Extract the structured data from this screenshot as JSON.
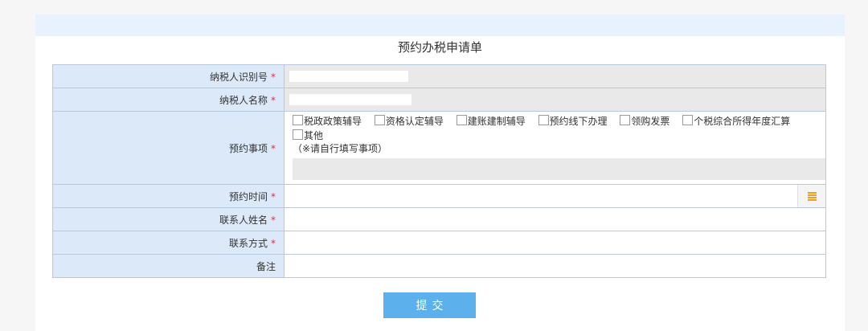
{
  "form": {
    "title": "预约办税申请单",
    "required_mark": "*",
    "fields": {
      "taxpayer_id": {
        "label": "纳税人识别号"
      },
      "taxpayer_name": {
        "label": "纳税人名称"
      },
      "appointment_matters": {
        "label": "预约事项",
        "options": [
          "税政政策辅导",
          "资格认定辅导",
          "建账建制辅导",
          "预约线下办理",
          "领购发票",
          "个税综合所得年度汇算",
          "其他"
        ],
        "hint": "（※请自行填写事项）"
      },
      "appointment_time": {
        "label": "预约时间"
      },
      "contact_name": {
        "label": "联系人姓名"
      },
      "contact_method": {
        "label": "联系方式"
      },
      "remarks": {
        "label": "备注"
      }
    },
    "submit_label": "提交"
  },
  "colors": {
    "header_bar": "#e8f2fd",
    "label_bg": "#dce9f8",
    "readonly_bg": "#e9e9e9",
    "required": "#e83030",
    "submit_bg": "#5cb0ec",
    "calendar_icon": "#f0a020"
  },
  "icons": {
    "appointment_time_picker": "calendar-icon"
  }
}
